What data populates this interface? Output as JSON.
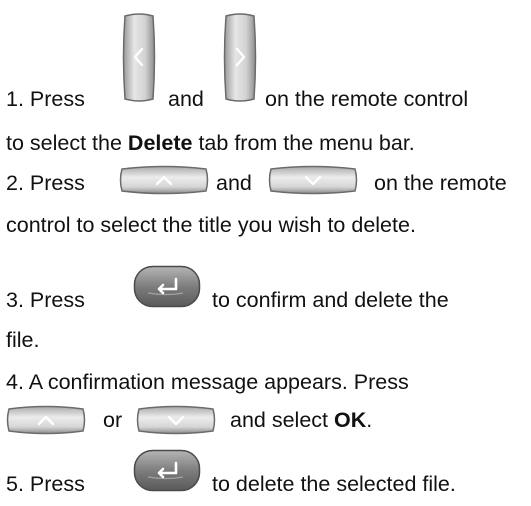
{
  "steps": {
    "s1": {
      "a": "1. Press",
      "b": "and",
      "c": "on the remote control",
      "d": "to select the",
      "e": "Delete",
      "f": "tab from the menu bar."
    },
    "s2": {
      "a": "2. Press",
      "b": "and",
      "c": "on the remote",
      "d": "control to select the title you wish to delete."
    },
    "s3": {
      "a": "3. Press",
      "b": "to confirm and delete the",
      "c": "file."
    },
    "s4": {
      "a": "4. A confirmation message appears. Press",
      "b": "or",
      "c": "and select",
      "d": "OK",
      "e": "."
    },
    "s5": {
      "a": "5. Press",
      "b": "to delete the selected file."
    }
  },
  "icons": {
    "left": "left-arrow-button-icon",
    "right": "right-arrow-button-icon",
    "up": "up-arrow-button-icon",
    "down": "down-arrow-button-icon",
    "enter": "enter-button-icon"
  },
  "colors": {
    "button_edge": "#6b6b6b",
    "button_face": "#cfcfcf",
    "enter_face": "#7a7a7a",
    "glyph": "#ffffff"
  }
}
